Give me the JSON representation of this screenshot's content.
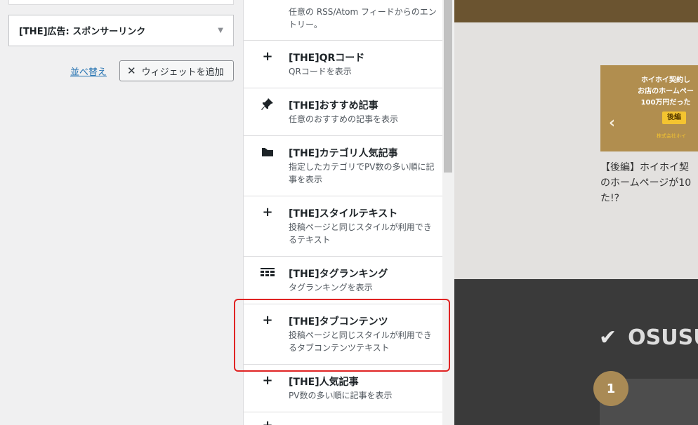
{
  "left": {
    "selected_widget": "[THE]広告: スポンサーリンク",
    "reorder_link": "並べ替え",
    "add_widget_button": "ウィジェットを追加"
  },
  "widget_list": [
    {
      "title": "",
      "description": "任意の RSS/Atom フィードからのエントリー。",
      "icon": "none"
    },
    {
      "title": "[THE]QRコード",
      "description": "QRコードを表示",
      "icon": "plus-icon"
    },
    {
      "title": "[THE]おすすめ記事",
      "description": "任意のおすすめの記事を表示",
      "icon": "pin-icon"
    },
    {
      "title": "[THE]カテゴリ人気記事",
      "description": "指定したカテゴリでPV数の多い順に記事を表示",
      "icon": "folder-icon"
    },
    {
      "title": "[THE]スタイルテキスト",
      "description": "投稿ページと同じスタイルが利用できるテキスト",
      "icon": "plus-icon"
    },
    {
      "title": "[THE]タグランキング",
      "description": "タグランキングを表示",
      "icon": "tag-ranking-icon"
    },
    {
      "title": "[THE]タブコンテンツ",
      "description": "投稿ページと同じスタイルが利用できるタブコンテンツテキスト",
      "icon": "plus-icon"
    },
    {
      "title": "[THE]人気記事",
      "description": "PV数の多い順に記事を表示",
      "icon": "plus-icon"
    }
  ],
  "preview": {
    "banner_text": "ホイホイ契約し\nお店のホームペー\n100万円だった",
    "banner_tag": "後編",
    "banner_brand": "株式会社ホイ",
    "article_title": "【後編】ホイホイ契\nのホームページが10\nた!?",
    "section_heading": "OSUSUM",
    "rank_number": "1"
  },
  "colors": {
    "highlight": "#e02424",
    "link": "#2271b1"
  }
}
